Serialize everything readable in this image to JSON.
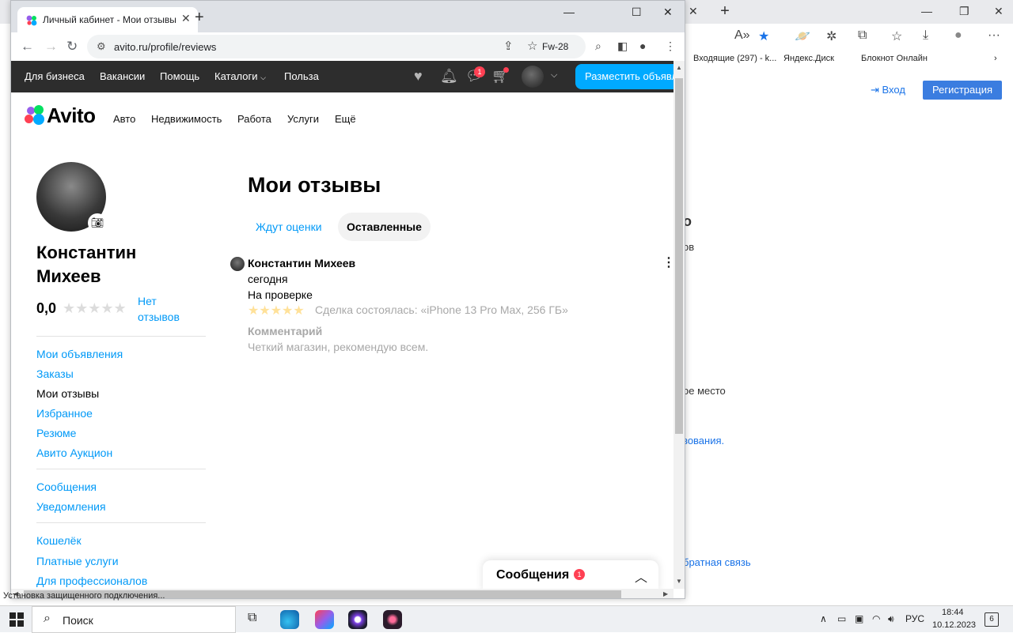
{
  "bg_window": {
    "bookmarks": [
      "Входящие (297) - k...",
      "Яндекс.Диск",
      "Блокнот Онлайн"
    ],
    "login_label": "Вход",
    "register_label": "Регистрация",
    "fragments": [
      "о",
      "ов",
      "ое место",
      "зования.",
      "братная связь"
    ]
  },
  "browser": {
    "tab_title": "Личный кабинет - Мои отзывы",
    "url": "avito.ru/profile/reviews",
    "extension_label": "Fw-28"
  },
  "topbar": {
    "links": [
      "Для бизнеса",
      "Вакансии",
      "Помощь",
      "Каталоги",
      "Польза"
    ],
    "messages_badge": "1",
    "post_button": "Разместить объявление"
  },
  "header": {
    "logo": "Avito",
    "categories": [
      "Авто",
      "Недвижимость",
      "Работа",
      "Услуги",
      "Ещё"
    ]
  },
  "profile": {
    "name": "Константин Михеев",
    "rating": "0,0",
    "no_reviews": "Нет отзывов"
  },
  "sidebar": {
    "group1": [
      "Мои объявления",
      "Заказы",
      "Мои отзывы",
      "Избранное",
      "Резюме",
      "Авито Аукцион"
    ],
    "group2": [
      "Сообщения",
      "Уведомления"
    ],
    "group3": [
      "Кошелёк",
      "Платные услуги",
      "Для профессионалов"
    ],
    "active": "Мои отзывы"
  },
  "main": {
    "title": "Мои отзывы",
    "tabs": [
      "Ждут оценки",
      "Оставленные"
    ],
    "active_tab": "Оставленные"
  },
  "review": {
    "author": "Константин Михеев",
    "date": "сегодня",
    "status": "На проверке",
    "stars": 5,
    "deal": "Сделка состоялась: «iPhone 13 Pro Max, 256 ГБ»",
    "comment_label": "Комментарий",
    "comment": "Четкий магазин, рекомендую всем."
  },
  "messages_popup": {
    "title": "Сообщения",
    "badge": "1"
  },
  "taskbar": {
    "search_placeholder": "Поиск",
    "lang": "РУС",
    "time": "18:44",
    "date": "10.12.2023",
    "notifications": "6"
  },
  "status_text": "Установка защищенного подключения..."
}
